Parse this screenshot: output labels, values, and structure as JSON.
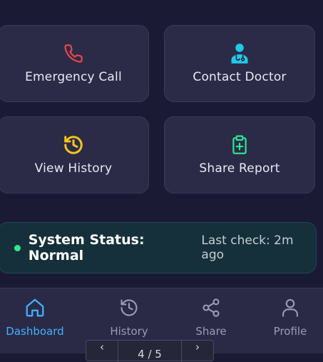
{
  "actions": [
    {
      "label": "Emergency Call",
      "icon": "phone-icon",
      "color": "#f04848"
    },
    {
      "label": "Contact Doctor",
      "icon": "doctor-icon",
      "color": "#22c8e8"
    },
    {
      "label": "View History",
      "icon": "history-icon",
      "color": "#f5c518"
    },
    {
      "label": "Share Report",
      "icon": "clipboard-plus-icon",
      "color": "#2ee88e"
    }
  ],
  "status": {
    "title": "System Status: Normal",
    "last_check": "Last check: 2m ago",
    "indicator_color": "#2ee88e"
  },
  "nav": {
    "items": [
      {
        "label": "Dashboard",
        "icon": "home-icon",
        "active": true
      },
      {
        "label": "History",
        "icon": "history-icon",
        "active": false
      },
      {
        "label": "Share",
        "icon": "share-icon",
        "active": false
      },
      {
        "label": "Profile",
        "icon": "user-icon",
        "active": false
      }
    ],
    "active_color": "#3fb3ff"
  },
  "pager": {
    "prev": "‹",
    "page": "4 / 5",
    "next": "›"
  }
}
